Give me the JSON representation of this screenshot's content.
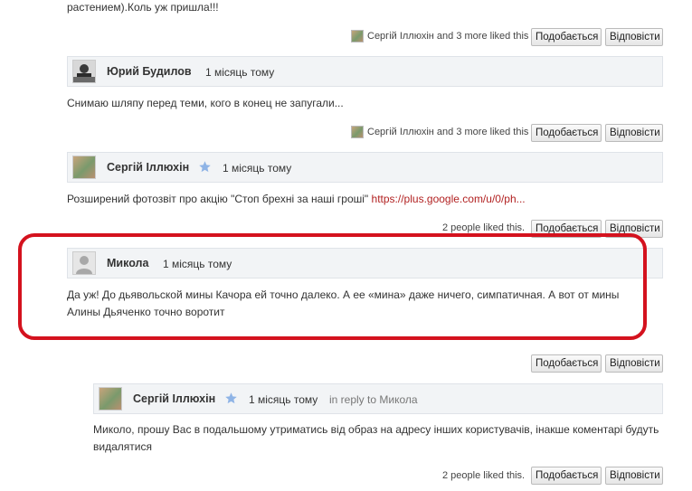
{
  "comments": [
    {
      "body_tail": "растением).Коль уж пришла!!!",
      "liked_text": "Сергій Іллюхін and 3 more liked this",
      "like_label": "Подобається",
      "reply_label": "Відповісти"
    },
    {
      "author": "Юрий Будилов",
      "time": "1 місяць тому",
      "body": "Снимаю шляпу перед теми, кого в конец не запугали...",
      "liked_text": "Сергій Іллюхін and 3 more liked this",
      "like_label": "Подобається",
      "reply_label": "Відповісти"
    },
    {
      "author": "Сергій Іллюхін",
      "time": "1 місяць тому",
      "body": "Розширений фотозвіт про акцію \"Стоп брехні за наші гроші\"",
      "link": "https://plus.google.com/u/0/ph...",
      "liked_text": "2 people liked this.",
      "like_label": "Подобається",
      "reply_label": "Відповісти"
    },
    {
      "author": "Микола",
      "time": "1 місяць тому",
      "body_line1": "Да уж! До дьявольской мины Качора ей точно далеко. А ее «мина» даже ничего, симпатичная. А вот от мины",
      "body_line2": "Алины Дьяченко точно воротит",
      "like_label": "Подобається",
      "reply_label": "Відповісти"
    },
    {
      "author": "Сергій Іллюхін",
      "time": "1 місяць тому",
      "in_reply_prefix": "in reply to",
      "in_reply_name": "Микола",
      "body_line1": "Миколо, прошу Вас в подальшому утриматись від образ на адресу інших користувачів, інакше коментарі будуть",
      "body_line2": "видалятися",
      "liked_text": "2 people liked this.",
      "like_label": "Подобається",
      "reply_label": "Відповісти"
    }
  ],
  "colors": {
    "highlight": "#d4121e",
    "link": "#b22222",
    "header_bg": "#f2f4f6",
    "star": "#8fb4e6"
  }
}
